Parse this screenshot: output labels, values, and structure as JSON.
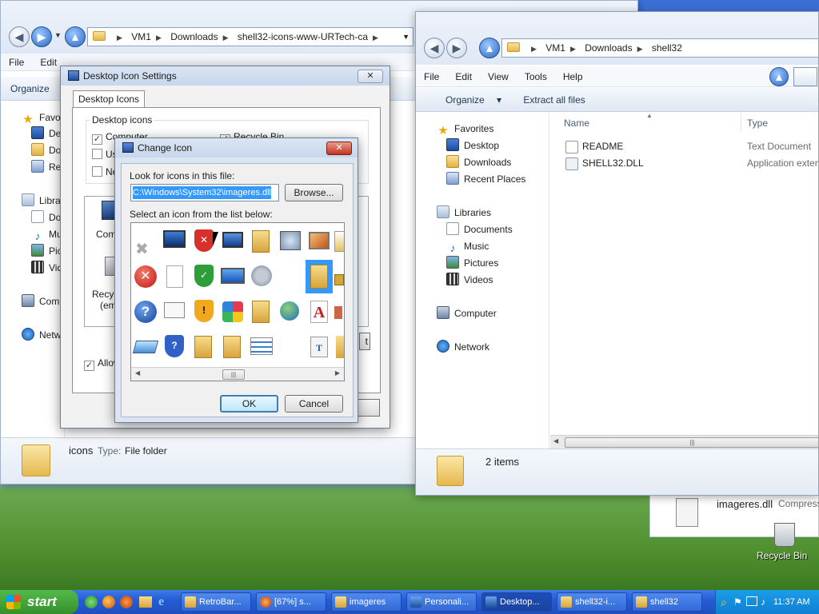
{
  "explorer_left": {
    "path": [
      "VM1",
      "Downloads",
      "shell32-icons-www-URTech-ca"
    ],
    "menu_file": "File",
    "menu_edit": "Edit",
    "organize": "Organize",
    "nav": [
      "Favo",
      "Des",
      "Dow",
      "Rec",
      "Libra",
      "Do",
      "Mu",
      "Pic",
      "Vid",
      "Com",
      "Netw"
    ],
    "details_name": "icons",
    "details_type_label": "Type:",
    "details_type_value": "File folder"
  },
  "explorer_right": {
    "path": [
      "VM1",
      "Downloads",
      "shell32"
    ],
    "menu": [
      "File",
      "Edit",
      "View",
      "Tools",
      "Help"
    ],
    "organize": "Organize",
    "extract": "Extract all files",
    "nav": {
      "favorites": "Favorites",
      "desktop": "Desktop",
      "downloads": "Downloads",
      "recent": "Recent Places",
      "libraries": "Libraries",
      "documents": "Documents",
      "music": "Music",
      "pictures": "Pictures",
      "videos": "Videos",
      "computer": "Computer",
      "network": "Network"
    },
    "col_name": "Name",
    "col_type": "Type",
    "files": [
      {
        "name": "README",
        "type": "Text Document"
      },
      {
        "name": "SHELL32.DLL",
        "type": "Application exten"
      }
    ],
    "status": "2 items"
  },
  "desktop_icon_settings": {
    "title": "Desktop Icon Settings",
    "tab": "Desktop Icons",
    "group": "Desktop icons",
    "chk_computer": "Computer",
    "chk_user": "Us",
    "chk_net": "Ne",
    "chk_recycle": "Recycle Bin",
    "preview_computer": "Comp",
    "preview_recycle": "Recyc",
    "preview_empty": "(emp",
    "allow": "Allow",
    "partial_btn": "t"
  },
  "change_icon": {
    "title": "Change Icon",
    "look_label": "Look for icons in this file:",
    "file_path": "C:\\Windows\\System32\\imageres.dll",
    "browse": "Browse...",
    "select_label": "Select an icon from the list below:",
    "ok": "OK",
    "cancel": "Cancel"
  },
  "desktop_file": {
    "name": "imageres.dll",
    "type": "Compress"
  },
  "recycle_bin": "Recycle Bin",
  "taskbar": {
    "start": "start",
    "tasks": [
      "RetroBar...",
      "[67%] s...",
      "imageres",
      "Personali...",
      "Desktop...",
      "shell32-i...",
      "shell32"
    ],
    "clock": "11:37 AM"
  },
  "colors": {
    "taskbar": "#245dd7",
    "start": "#36902c",
    "selection": "#3399ff"
  }
}
